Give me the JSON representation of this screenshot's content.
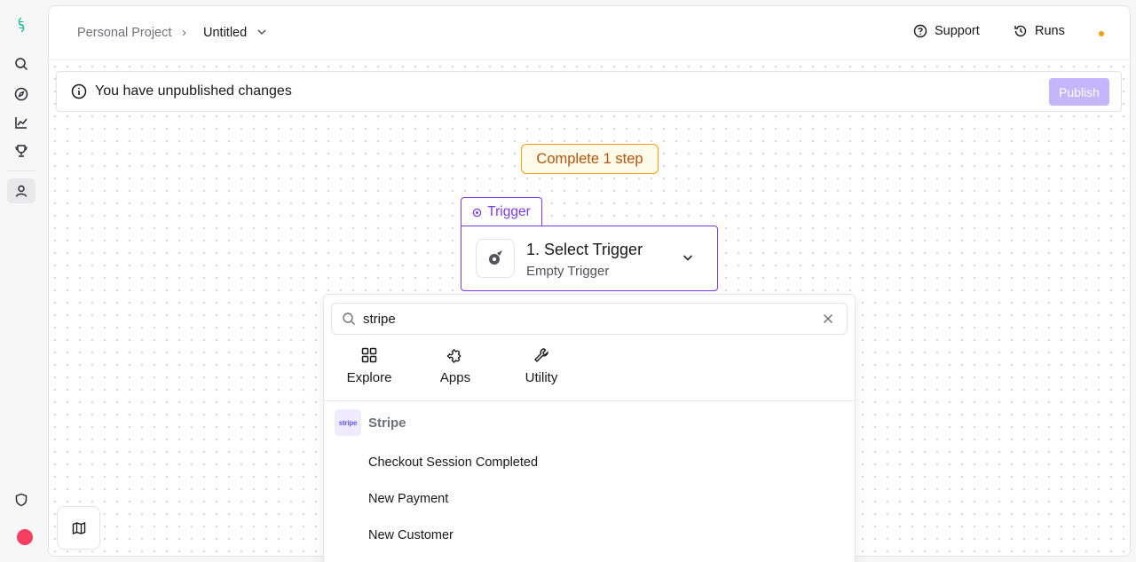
{
  "header": {
    "breadcrumb_project": "Personal Project",
    "breadcrumb_separator": "›",
    "flow_title": "Untitled",
    "support_label": "Support",
    "runs_label": "Runs",
    "status_color": "#f59e0b"
  },
  "banner": {
    "message": "You have unpublished changes",
    "publish_label": "Publish"
  },
  "canvas": {
    "complete_label": "Complete 1 step",
    "trigger_tab_label": "Trigger",
    "trigger_title": "1. Select Trigger",
    "trigger_subtitle": "Empty Trigger"
  },
  "picker": {
    "search_value": "stripe",
    "categories": [
      {
        "label": "Explore",
        "icon": "grid-icon"
      },
      {
        "label": "Apps",
        "icon": "puzzle-icon"
      },
      {
        "label": "Utility",
        "icon": "wrench-icon"
      }
    ],
    "group": {
      "logo_text": "stripe",
      "label": "Stripe"
    },
    "results": [
      "Checkout Session Completed",
      "New Payment",
      "New Customer"
    ]
  },
  "colors": {
    "accent": "#7c3aed",
    "publish_disabled": "#c4b5fd",
    "warning": "#f59e0b",
    "avatar": "#f43f5e"
  }
}
